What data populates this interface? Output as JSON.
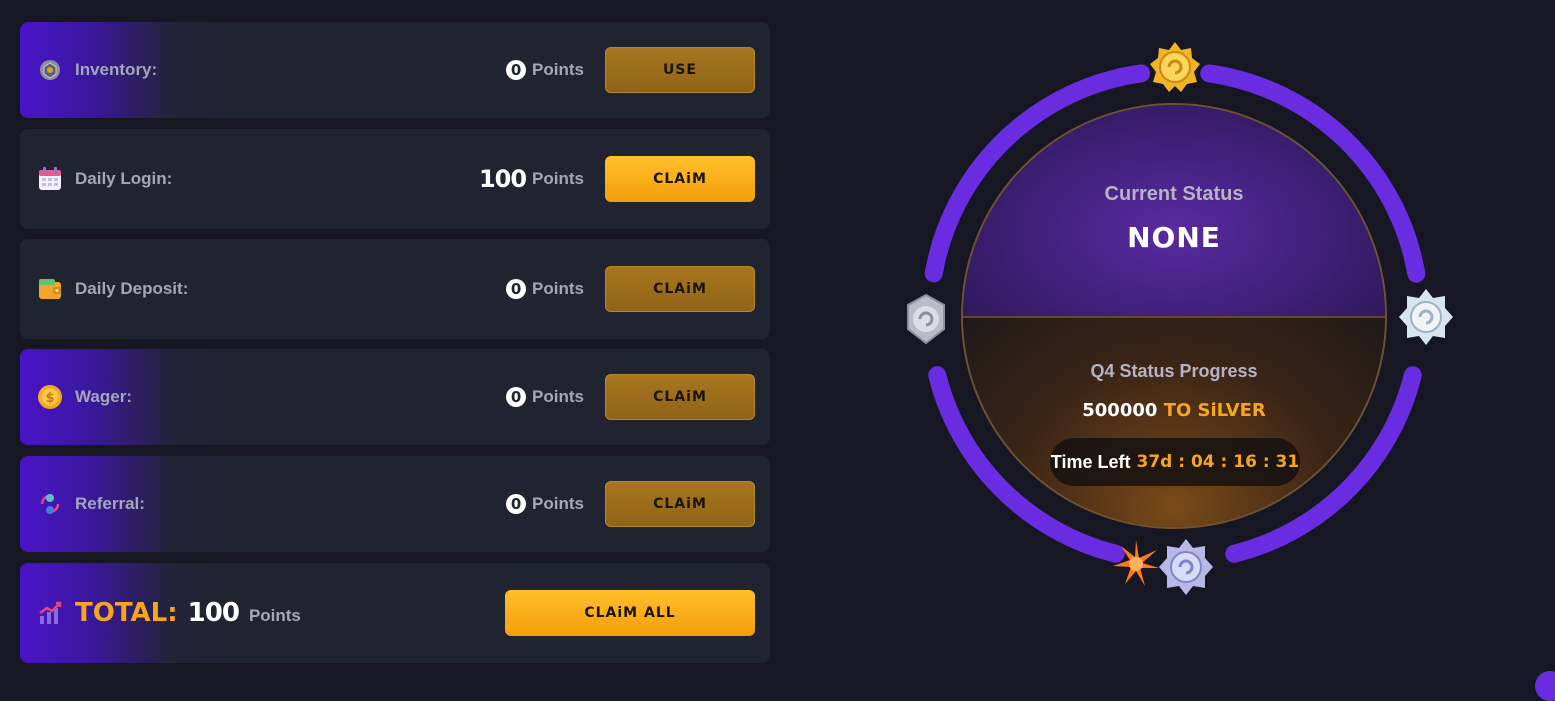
{
  "rewards": [
    {
      "icon": "chest-icon",
      "label": "Inventory:",
      "points": "0",
      "unit": "Points",
      "button": "USE",
      "active": false,
      "highlight": true
    },
    {
      "icon": "calendar-icon",
      "label": "Daily Login:",
      "points": "100",
      "unit": "Points",
      "button": "CLAiM",
      "active": true,
      "highlight": false
    },
    {
      "icon": "wallet-icon",
      "label": "Daily Deposit:",
      "points": "0",
      "unit": "Points",
      "button": "CLAiM",
      "active": false,
      "highlight": false
    },
    {
      "icon": "coin-icon",
      "label": "Wager:",
      "points": "0",
      "unit": "Points",
      "button": "CLAiM",
      "active": false,
      "highlight": true
    },
    {
      "icon": "referral-icon",
      "label": "Referral:",
      "points": "0",
      "unit": "Points",
      "button": "CLAiM",
      "active": false,
      "highlight": true
    }
  ],
  "total": {
    "icon": "chart-icon",
    "label": "TOTAL:",
    "points": "100",
    "unit": "Points",
    "button": "CLAiM ALL"
  },
  "status": {
    "current_label": "Current Status",
    "current_value": "NONE",
    "progress_label": "Q4 Status Progress",
    "progress_points": "500000",
    "progress_target": "TO SiLVER",
    "time_left_label": "Time Left",
    "time_left_value": "37d : 04 : 16 : 31",
    "progress_fraction": 0.02
  },
  "colors": {
    "accent_purple": "#6a2ce0",
    "accent_orange": "#f6a51f",
    "button_dim": "#a8761e",
    "button_bright": "#ffc02a"
  }
}
